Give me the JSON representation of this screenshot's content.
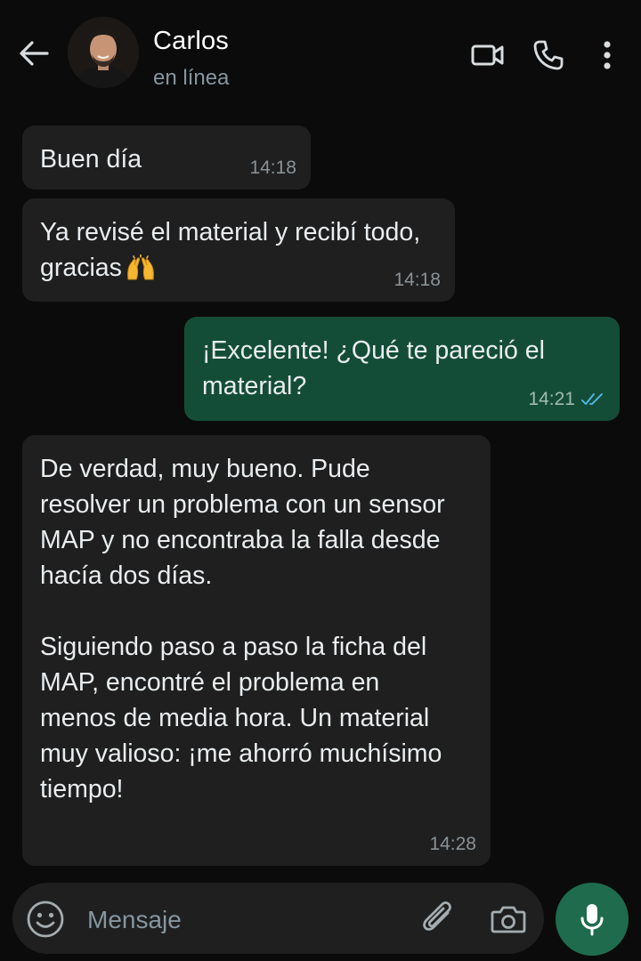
{
  "header": {
    "contact_name": "Carlos",
    "status": "en línea",
    "icons": {
      "back": "arrow-back-icon",
      "avatar": "avatar",
      "video": "video-call-icon",
      "call": "phone-icon",
      "menu": "more-vertical-icon"
    }
  },
  "messages": [
    {
      "direction": "incoming",
      "text": "Buen día",
      "time": "14:18"
    },
    {
      "direction": "incoming",
      "text": "Ya revisé el material y recibí todo,\ngracias",
      "emoji": "raising-hands-emoji",
      "time": "14:18"
    },
    {
      "direction": "outgoing",
      "text": "¡Excelente! ¿Qué te pareció el\nmaterial?",
      "time": "14:21",
      "status": "read"
    },
    {
      "direction": "incoming",
      "text": "De verdad, muy bueno. Pude\nresolver un problema con un sensor\nMAP y no encontraba la falla desde\nhacía dos días.\n\nSiguiendo paso a paso la ficha del\nMAP, encontré el problema en\nmenos de media hora. Un material\nmuy valioso: ¡me ahorró muchísimo\ntiempo!",
      "time": "14:28"
    }
  ],
  "composer": {
    "placeholder": "Mensaje",
    "value": "",
    "icons": {
      "emoji": "emoji-icon",
      "attach": "paperclip-icon",
      "camera": "camera-icon",
      "mic": "microphone-icon"
    }
  },
  "colors": {
    "background": "#0b0b0b",
    "incoming_bubble": "#1f1f1f",
    "outgoing_bubble": "#144d37",
    "read_ticks": "#53bdeb",
    "mic_button": "#1f6b4e"
  }
}
